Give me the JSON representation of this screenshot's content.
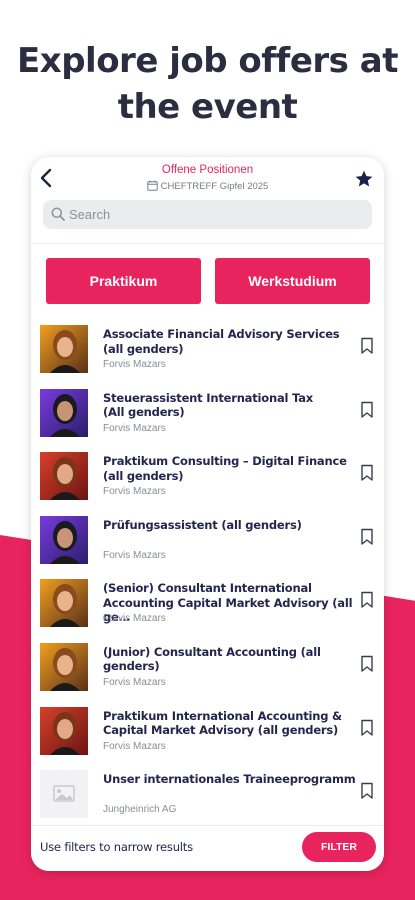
{
  "headline": "Explore job offers at the event",
  "colors": {
    "accent": "#e8245f",
    "text_dark": "#23264d",
    "muted": "#8a8d98"
  },
  "screen": {
    "title": "Offene Positionen",
    "subtitle": "CHEFTREFF Gipfel 2025",
    "search_placeholder": "Search",
    "icons": {
      "back": "chevron-left-icon",
      "favorite": "star-icon",
      "calendar": "calendar-icon",
      "search": "search-icon"
    },
    "categories": [
      {
        "label": "Praktikum"
      },
      {
        "label": "Werkstudium"
      }
    ],
    "jobs": [
      {
        "title": "Associate Financial Advisory Services\n(all genders)",
        "company": "Forvis Mazars",
        "thumb": "woman-portrait"
      },
      {
        "title": "Steuerassistent International Tax\n(All genders)",
        "company": "Forvis Mazars",
        "thumb": "man-portrait"
      },
      {
        "title": "Praktikum Consulting – Digital Finance\n(all genders)",
        "company": "Forvis Mazars",
        "thumb": "woman-portrait-red"
      },
      {
        "title": "Prüfungsassistent (all genders)",
        "company": "Forvis Mazars",
        "thumb": "man-portrait"
      },
      {
        "title": "(Senior) Consultant International\nAccounting Capital Market Advisory (all ge…",
        "company": "Forvis Mazars",
        "thumb": "woman-portrait"
      },
      {
        "title": "(Junior) Consultant Accounting (all genders)",
        "company": "Forvis Mazars",
        "thumb": "woman-portrait"
      },
      {
        "title": "Praktikum International Accounting &\nCapital Market Advisory (all genders)",
        "company": "Forvis Mazars",
        "thumb": "woman-portrait-red"
      },
      {
        "title": "Unser internationales Traineeprogramm",
        "company": "Jungheinrich AG",
        "thumb": "image-placeholder"
      }
    ],
    "footer": {
      "hint": "Use filters to narrow results",
      "filter_label": "FILTER"
    }
  }
}
